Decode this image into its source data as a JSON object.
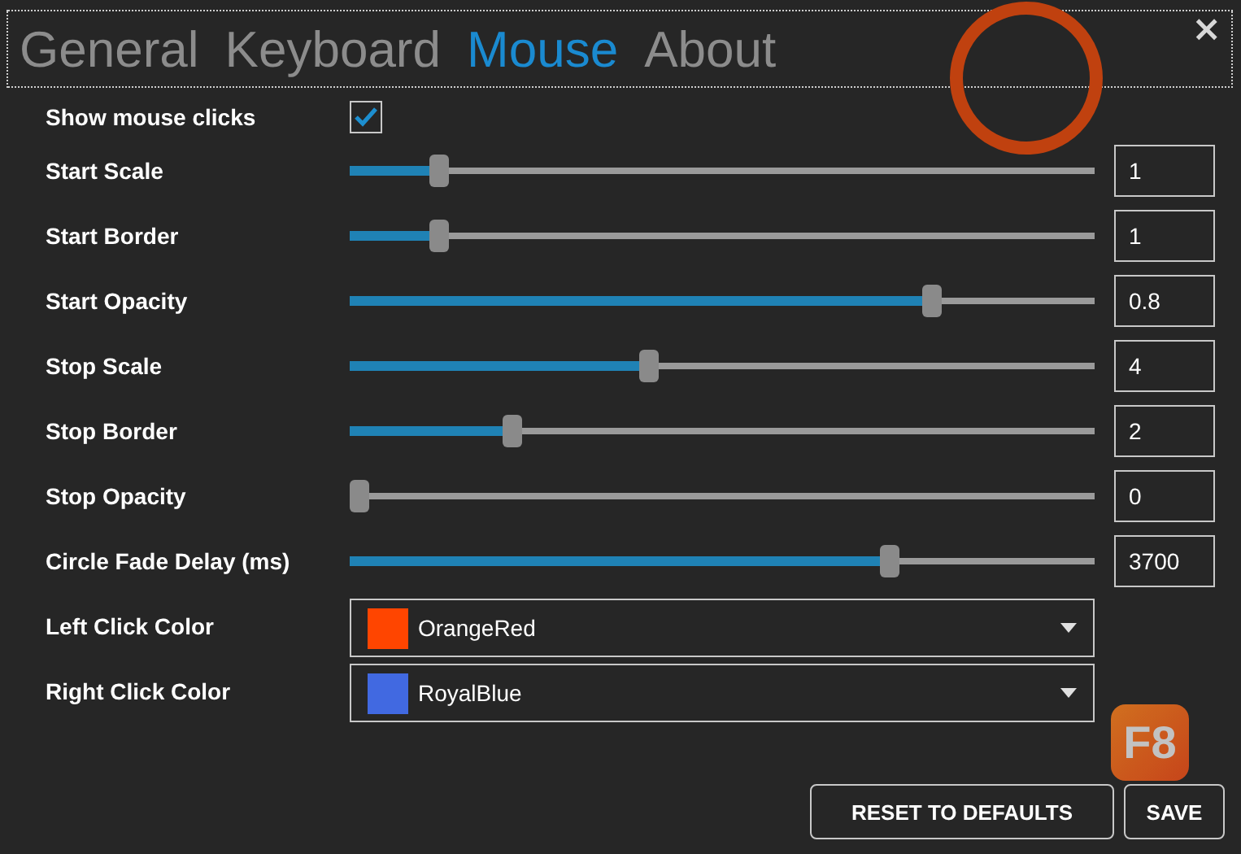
{
  "tabs": [
    {
      "label": "General",
      "selected": false
    },
    {
      "label": "Keyboard",
      "selected": false
    },
    {
      "label": "Mouse",
      "selected": true
    },
    {
      "label": "About",
      "selected": false
    }
  ],
  "close": "×",
  "show_clicks": {
    "label": "Show mouse clicks",
    "checked": true
  },
  "sliders": [
    {
      "label": "Start Scale",
      "level": 0.11,
      "value": "1"
    },
    {
      "label": "Start Border",
      "level": 0.11,
      "value": "1"
    },
    {
      "label": "Start Opacity",
      "level": 0.79,
      "value": "0.8"
    },
    {
      "label": "Stop Scale",
      "level": 0.4,
      "value": "4"
    },
    {
      "label": "Stop Border",
      "level": 0.21,
      "value": "2"
    },
    {
      "label": "Stop Opacity",
      "level": 0.0,
      "value": "0"
    },
    {
      "label": "Circle Fade Delay (ms)",
      "level": 0.73,
      "value": "3700"
    }
  ],
  "colors": [
    {
      "label": "Left Click Color",
      "value": "OrangeRed",
      "color": "#ff4500"
    },
    {
      "label": "Right Click Color",
      "value": "RoyalBlue",
      "color": "#4169e1"
    }
  ],
  "buttons": [
    "RESET TO DEFAULTS",
    "SAVE"
  ],
  "badge": "F8"
}
